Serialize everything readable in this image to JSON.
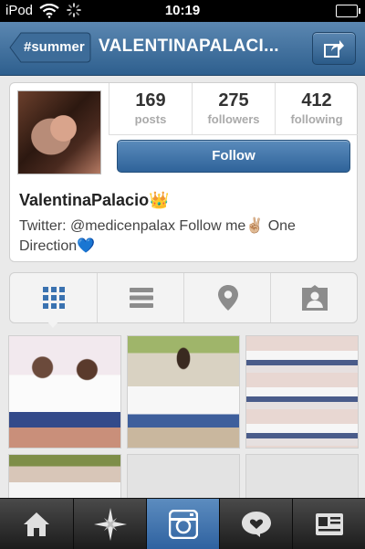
{
  "status_bar": {
    "carrier": "iPod",
    "time": "10:19"
  },
  "nav": {
    "back_label": "#summer",
    "title": "VALENTINAPALACI..."
  },
  "profile": {
    "stats": [
      {
        "value": "169",
        "label": "posts"
      },
      {
        "value": "275",
        "label": "followers"
      },
      {
        "value": "412",
        "label": "following"
      }
    ],
    "follow_label": "Follow",
    "username": "ValentinaPalacio👑",
    "bio": "Twitter: @medicenpalax Follow me✌🏼 One Direction💙"
  },
  "tabs": [
    "grid-view-icon",
    "list-view-icon",
    "map-pin-icon",
    "tagged-photos-icon"
  ],
  "bottom_bar": [
    "home-icon",
    "explore-icon",
    "camera-icon",
    "news-icon",
    "profile-icon"
  ],
  "colors": {
    "nav_blue": "#3a6b9a",
    "follow_blue": "#2f639a",
    "active_tab": "#3a72b0"
  }
}
